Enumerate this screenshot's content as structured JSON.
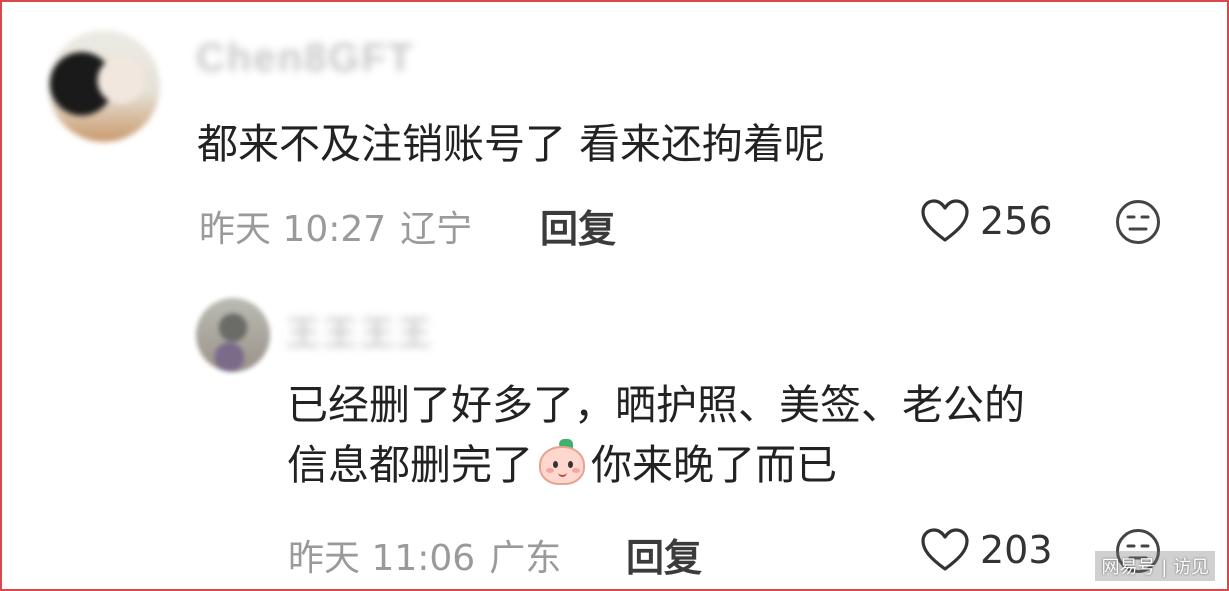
{
  "comments": [
    {
      "text": "都来不及注销账号了 看来还拘着呢",
      "time": "昨天 10:27",
      "location": "辽宁",
      "reply_label": "回复",
      "likes": "256",
      "username": "Chen8GFT"
    },
    {
      "text_line1": "已经删了好多了，晒护照、美签、老公的",
      "text_line2_before": "信息都删完了",
      "text_line2_after": "你来晚了而已",
      "time": "昨天 11:06",
      "location": "广东",
      "reply_label": "回复",
      "likes": "203",
      "username": "王王王王"
    }
  ],
  "watermark": "网易号 | 访见",
  "colors": {
    "border": "#d9484a",
    "text": "#222222",
    "meta": "#9a9a9a"
  },
  "icons": {
    "like": "heart-outline-icon",
    "dislike": "neutral-face-icon",
    "emoji": "peach-face-emoji"
  }
}
